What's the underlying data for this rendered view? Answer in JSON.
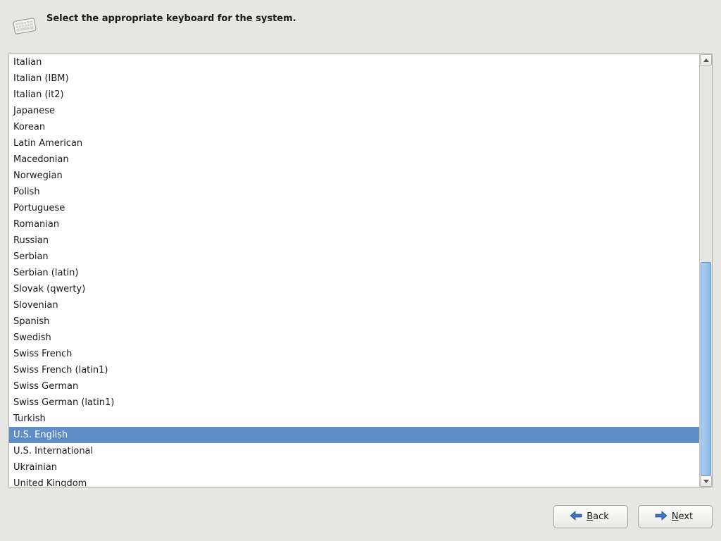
{
  "header": {
    "instruction": "Select the appropriate keyboard for the system."
  },
  "list": {
    "selected_index": 23,
    "items": [
      "Italian",
      "Italian (IBM)",
      "Italian (it2)",
      "Japanese",
      "Korean",
      "Latin American",
      "Macedonian",
      "Norwegian",
      "Polish",
      "Portuguese",
      "Romanian",
      "Russian",
      "Serbian",
      "Serbian (latin)",
      "Slovak (qwerty)",
      "Slovenian",
      "Spanish",
      "Swedish",
      "Swiss French",
      "Swiss French (latin1)",
      "Swiss German",
      "Swiss German (latin1)",
      "Turkish",
      "U.S. English",
      "U.S. International",
      "Ukrainian",
      "United Kingdom"
    ]
  },
  "scrollbar": {
    "thumb_top_pct": 48,
    "thumb_height_pct": 52
  },
  "footer": {
    "back_label": "Back",
    "next_label": "Next"
  }
}
